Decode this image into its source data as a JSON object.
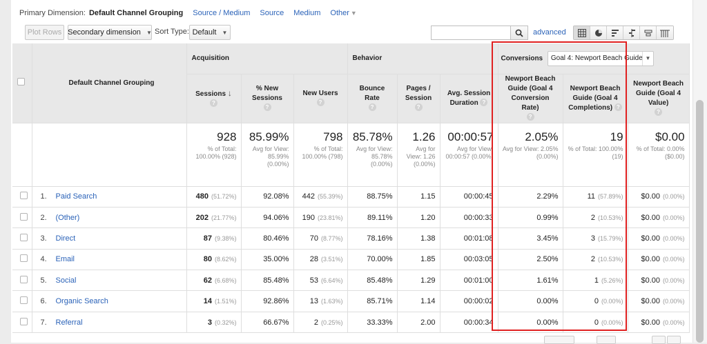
{
  "primary_dimension": {
    "label": "Primary Dimension:",
    "active": "Default Channel Grouping",
    "options": [
      "Source / Medium",
      "Source",
      "Medium",
      "Other"
    ]
  },
  "toolbar": {
    "plot_rows": "Plot Rows",
    "secondary_dimension": "Secondary dimension",
    "sort_type_label": "Sort Type:",
    "sort_type_value": "Default",
    "search_value": "",
    "advanced": "advanced"
  },
  "view_buttons": [
    "table-view-icon",
    "pie-view-icon",
    "performance-view-icon",
    "comparison-view-icon",
    "term-cloud-icon",
    "pivot-view-icon"
  ],
  "groups": {
    "acquisition": "Acquisition",
    "behavior": "Behavior",
    "conversions": "Conversions",
    "goal_select": "Goal 4: Newport Beach Guide"
  },
  "columns": {
    "dimension": "Default Channel Grouping",
    "sessions": "Sessions",
    "new_sessions": "% New Sessions",
    "new_users": "New Users",
    "bounce_rate": "Bounce Rate",
    "pages_session": "Pages / Session",
    "avg_duration": "Avg. Session Duration",
    "conv_rate": "Newport Beach Guide (Goal 4 Conversion Rate)",
    "completions": "Newport Beach Guide (Goal 4 Completions)",
    "value": "Newport Beach Guide (Goal 4 Value)"
  },
  "totals": {
    "sessions": {
      "main": "928",
      "sub": "% of Total: 100.00% (928)"
    },
    "new_sessions": {
      "main": "85.99%",
      "sub": "Avg for View: 85.99% (0.00%)"
    },
    "new_users": {
      "main": "798",
      "sub": "% of Total: 100.00% (798)"
    },
    "bounce_rate": {
      "main": "85.78%",
      "sub": "Avg for View: 85.78% (0.00%)"
    },
    "pages_session": {
      "main": "1.26",
      "sub": "Avg for View: 1.26 (0.00%)"
    },
    "avg_duration": {
      "main": "00:00:57",
      "sub": "Avg for View: 00:00:57 (0.00%)"
    },
    "conv_rate": {
      "main": "2.05%",
      "sub": "Avg for View: 2.05% (0.00%)"
    },
    "completions": {
      "main": "19",
      "sub": "% of Total: 100.00% (19)"
    },
    "value": {
      "main": "$0.00",
      "sub": "% of Total: 0.00% ($0.00)"
    }
  },
  "rows": [
    {
      "idx": "1.",
      "name": "Paid Search",
      "sessions": "480",
      "sessions_pct": "(51.72%)",
      "new_sessions": "92.08%",
      "new_users": "442",
      "new_users_pct": "(55.39%)",
      "bounce_rate": "88.75%",
      "pages_session": "1.15",
      "avg_duration": "00:00:45",
      "conv_rate": "2.29%",
      "completions": "11",
      "completions_pct": "(57.89%)",
      "value": "$0.00",
      "value_pct": "(0.00%)"
    },
    {
      "idx": "2.",
      "name": "(Other)",
      "sessions": "202",
      "sessions_pct": "(21.77%)",
      "new_sessions": "94.06%",
      "new_users": "190",
      "new_users_pct": "(23.81%)",
      "bounce_rate": "89.11%",
      "pages_session": "1.20",
      "avg_duration": "00:00:33",
      "conv_rate": "0.99%",
      "completions": "2",
      "completions_pct": "(10.53%)",
      "value": "$0.00",
      "value_pct": "(0.00%)"
    },
    {
      "idx": "3.",
      "name": "Direct",
      "sessions": "87",
      "sessions_pct": "(9.38%)",
      "new_sessions": "80.46%",
      "new_users": "70",
      "new_users_pct": "(8.77%)",
      "bounce_rate": "78.16%",
      "pages_session": "1.38",
      "avg_duration": "00:01:08",
      "conv_rate": "3.45%",
      "completions": "3",
      "completions_pct": "(15.79%)",
      "value": "$0.00",
      "value_pct": "(0.00%)"
    },
    {
      "idx": "4.",
      "name": "Email",
      "sessions": "80",
      "sessions_pct": "(8.62%)",
      "new_sessions": "35.00%",
      "new_users": "28",
      "new_users_pct": "(3.51%)",
      "bounce_rate": "70.00%",
      "pages_session": "1.85",
      "avg_duration": "00:03:05",
      "conv_rate": "2.50%",
      "completions": "2",
      "completions_pct": "(10.53%)",
      "value": "$0.00",
      "value_pct": "(0.00%)"
    },
    {
      "idx": "5.",
      "name": "Social",
      "sessions": "62",
      "sessions_pct": "(6.68%)",
      "new_sessions": "85.48%",
      "new_users": "53",
      "new_users_pct": "(6.64%)",
      "bounce_rate": "85.48%",
      "pages_session": "1.29",
      "avg_duration": "00:01:00",
      "conv_rate": "1.61%",
      "completions": "1",
      "completions_pct": "(5.26%)",
      "value": "$0.00",
      "value_pct": "(0.00%)"
    },
    {
      "idx": "6.",
      "name": "Organic Search",
      "sessions": "14",
      "sessions_pct": "(1.51%)",
      "new_sessions": "92.86%",
      "new_users": "13",
      "new_users_pct": "(1.63%)",
      "bounce_rate": "85.71%",
      "pages_session": "1.14",
      "avg_duration": "00:00:02",
      "conv_rate": "0.00%",
      "completions": "0",
      "completions_pct": "(0.00%)",
      "value": "$0.00",
      "value_pct": "(0.00%)"
    },
    {
      "idx": "7.",
      "name": "Referral",
      "sessions": "3",
      "sessions_pct": "(0.32%)",
      "new_sessions": "66.67%",
      "new_users": "2",
      "new_users_pct": "(0.25%)",
      "bounce_rate": "33.33%",
      "pages_session": "2.00",
      "avg_duration": "00:00:34",
      "conv_rate": "0.00%",
      "completions": "0",
      "completions_pct": "(0.00%)",
      "value": "$0.00",
      "value_pct": "(0.00%)"
    }
  ],
  "colors": {
    "link": "#2a62b8",
    "highlight": "#e02020",
    "header_bg": "#e8e8e8"
  }
}
